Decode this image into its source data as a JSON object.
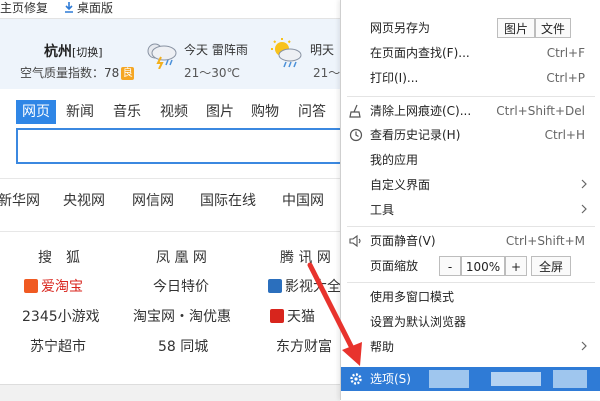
{
  "topbar": {
    "home_fix": "主页修复",
    "desktop_ver": "桌面版"
  },
  "weather": {
    "city": "杭州",
    "city_tag": "[切换]",
    "aqi_label": "空气质量指数：78",
    "aqi_badge": "良",
    "today_label": "今天 雷阵雨",
    "today_temp": "21～30℃",
    "tomorrow_label": "明天",
    "tomorrow_temp": "21～"
  },
  "search": {
    "tabs": [
      "网页",
      "新闻",
      "音乐",
      "视频",
      "图片",
      "购物",
      "问答"
    ],
    "active_tab": "网页"
  },
  "sites": [
    "新华网",
    "央视网",
    "网信网",
    "国际在线",
    "中国网"
  ],
  "links": [
    [
      "搜　狐",
      "凤 凰 网",
      "腾 讯 网"
    ],
    [
      "爱淘宝",
      "今日特价",
      "影视大全"
    ],
    [
      "2345小游戏",
      "淘宝网・淘优惠",
      "天猫"
    ],
    [
      "苏宁超市",
      "58 同城",
      "东方财富"
    ]
  ],
  "menu": {
    "save_as": "网页另存为",
    "save_as_img": "图片",
    "save_as_file": "文件",
    "find": "在页面内查找(F)...",
    "find_sc": "Ctrl+F",
    "print": "打印(I)...",
    "print_sc": "Ctrl+P",
    "clear": "清除上网痕迹(C)...",
    "clear_sc": "Ctrl+Shift+Del",
    "history": "查看历史记录(H)",
    "history_sc": "Ctrl+H",
    "my_apps": "我的应用",
    "custom_ui": "自定义界面",
    "tools": "工具",
    "mute": "页面静音(V)",
    "mute_sc": "Ctrl+Shift+M",
    "zoom": "页面缩放",
    "zoom_minus": "-",
    "zoom_value": "100%",
    "zoom_plus": "+",
    "fullscreen": "全屏",
    "multi_window": "使用多窗口模式",
    "default_browser": "设置为默认浏览器",
    "help": "帮助",
    "options": "选项(S)"
  },
  "colors": {
    "accent": "#2f7bd6",
    "search_border": "#3b88e0",
    "arrow": "#e8332d"
  }
}
